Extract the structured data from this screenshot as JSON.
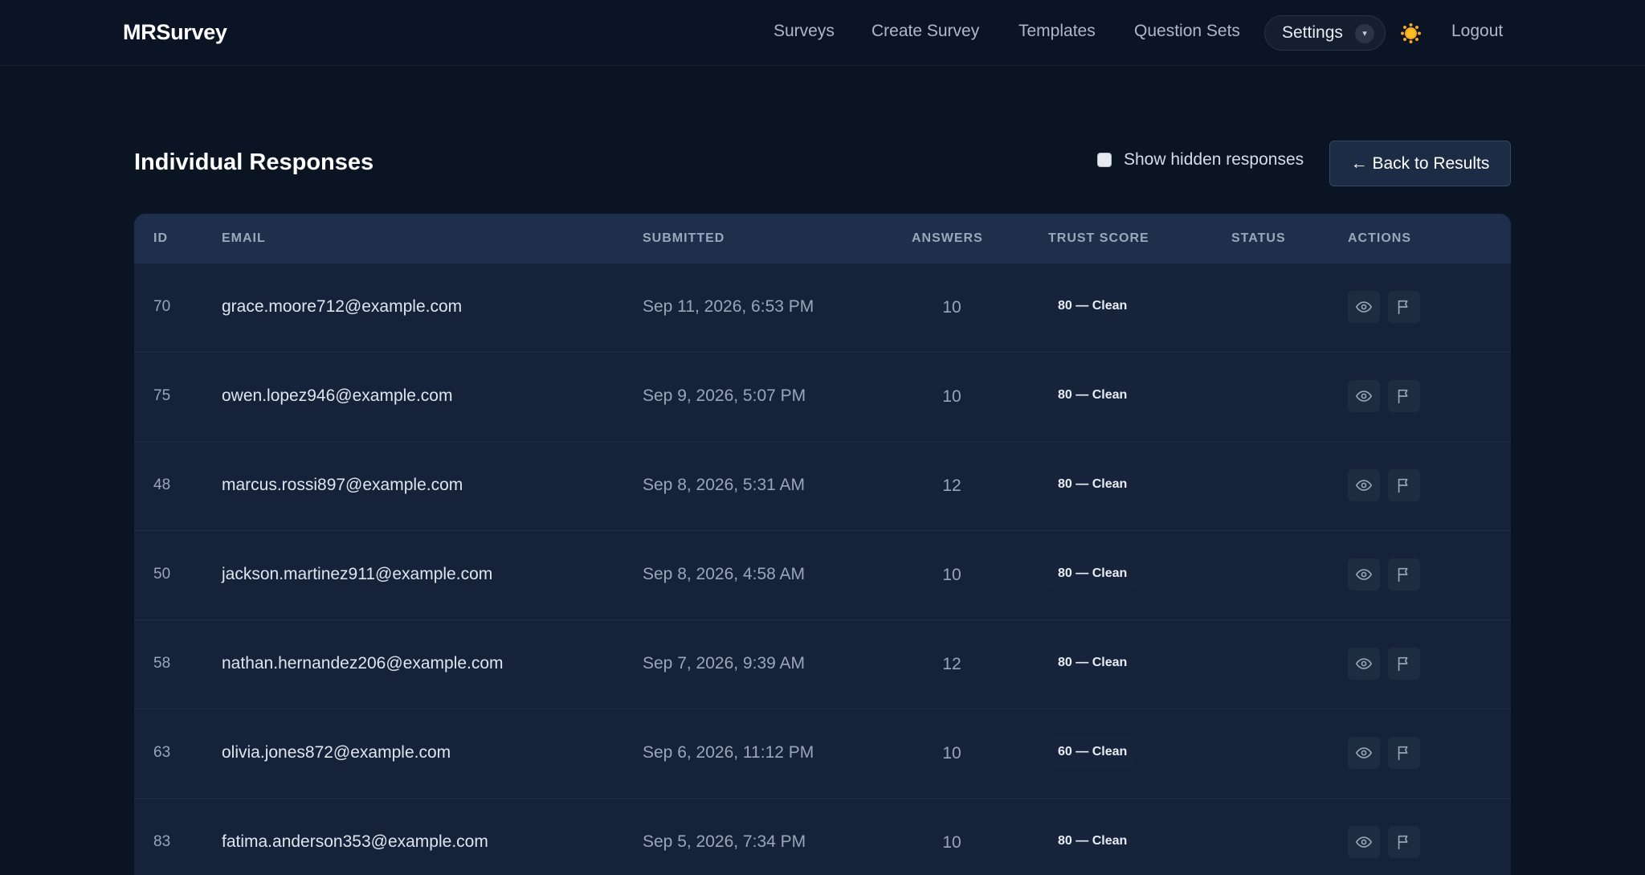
{
  "app": {
    "brand": "MRSurvey"
  },
  "nav": {
    "surveys": "Surveys",
    "create_survey": "Create Survey",
    "templates": "Templates",
    "question_sets": "Question Sets",
    "settings": "Settings",
    "settings_caret": "▾",
    "theme_icon": "sun-icon",
    "logout": "Logout"
  },
  "page": {
    "title": "Individual Responses",
    "show_hidden_label": "Show hidden responses",
    "show_hidden_checked": false,
    "back_button": "← Back to Results"
  },
  "table": {
    "headers": {
      "id": "ID",
      "email": "EMAIL",
      "submitted": "SUBMITTED",
      "answers": "ANSWERS",
      "trust_score": "TRUST SCORE",
      "status": "STATUS",
      "actions": "ACTIONS"
    },
    "rows": [
      {
        "id": "70",
        "email": "grace.moore712@example.com",
        "submitted": "Sep 11, 2026, 6:53 PM",
        "answers": "10",
        "trust": "80 — Clean",
        "status": ""
      },
      {
        "id": "75",
        "email": "owen.lopez946@example.com",
        "submitted": "Sep 9, 2026, 5:07 PM",
        "answers": "10",
        "trust": "80 — Clean",
        "status": ""
      },
      {
        "id": "48",
        "email": "marcus.rossi897@example.com",
        "submitted": "Sep 8, 2026, 5:31 AM",
        "answers": "12",
        "trust": "80 — Clean",
        "status": ""
      },
      {
        "id": "50",
        "email": "jackson.martinez911@example.com",
        "submitted": "Sep 8, 2026, 4:58 AM",
        "answers": "10",
        "trust": "80 — Clean",
        "status": ""
      },
      {
        "id": "58",
        "email": "nathan.hernandez206@example.com",
        "submitted": "Sep 7, 2026, 9:39 AM",
        "answers": "12",
        "trust": "80 — Clean",
        "status": ""
      },
      {
        "id": "63",
        "email": "olivia.jones872@example.com",
        "submitted": "Sep 6, 2026, 11:12 PM",
        "answers": "10",
        "trust": "60 — Clean",
        "status": ""
      },
      {
        "id": "83",
        "email": "fatima.anderson353@example.com",
        "submitted": "Sep 5, 2026, 7:34 PM",
        "answers": "10",
        "trust": "80 — Clean",
        "status": ""
      }
    ],
    "action_icons": {
      "view": "eye-icon",
      "flag": "flag-icon"
    }
  },
  "colors": {
    "background": "#0b1423",
    "nav_background": "#0a1424",
    "table_header": "#1d2f4b",
    "table_body": "#15223a",
    "theme_sun": "#f5a623"
  }
}
